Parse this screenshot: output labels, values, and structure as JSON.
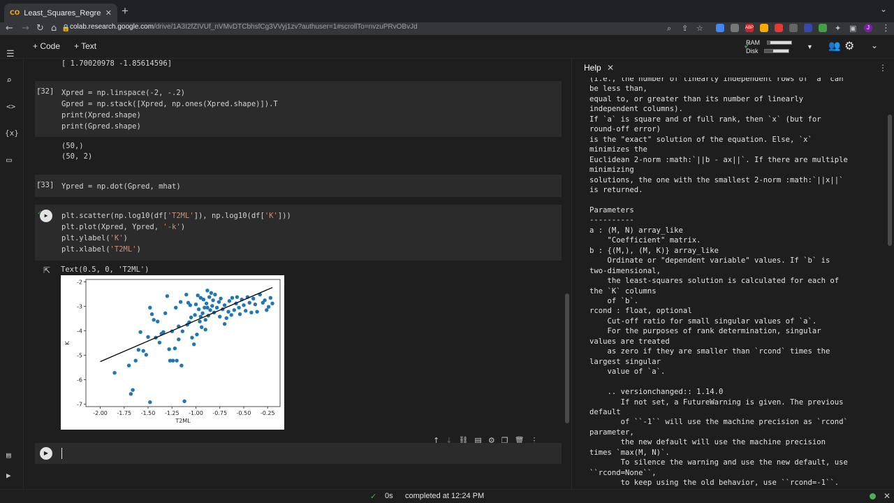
{
  "browser": {
    "tab_title": "Least_Squares_Regression_Py",
    "logo_text": "CO",
    "close_glyph": "✕",
    "new_tab_glyph": "+",
    "url_host": "colab.research.google.com",
    "url_path": "/drive/1A3I2fZIVUf_nVMvDTCbhsfCg3VVyj1zv?authuser=1#scrollTo=nvzuPRvOBvJd"
  },
  "toolbar": {
    "add_code": "+ Code",
    "add_text": "+ Text",
    "ram_label": "RAM",
    "disk_label": "Disk",
    "ram_fraction": 0.12,
    "disk_fraction": 0.38
  },
  "notebook": {
    "prev_output": "[ 1.70020978 -1.85614596]",
    "cells": [
      {
        "number": "[32]",
        "code": "Xpred = np.linspace(-2, -.2)\nGpred = np.stack([Xpred, np.ones(Xpred.shape)]).T\nprint(Xpred.shape)\nprint(Gpred.shape)",
        "output": "(50,)\n(50, 2)"
      },
      {
        "number": "[33]",
        "code": "Ypred = np.dot(Gpred, mhat)"
      },
      {
        "code_line1_a": "plt.scatter(np.log10(df[",
        "code_line1_s1": "'T2ML'",
        "code_line1_b": "]), np.log10(df[",
        "code_line1_s2": "'K'",
        "code_line1_c": "]))",
        "code_line2_a": "plt.plot(Xpred, Ypred, ",
        "code_line2_s": "'-k'",
        "code_line2_b": ")",
        "code_line3_a": "plt.ylabel(",
        "code_line3_s": "'K'",
        "code_line3_b": ")",
        "code_line4_a": "plt.xlabel(",
        "code_line4_s": "'T2ML'",
        "code_line4_b": ")",
        "output": "Text(0.5, 0, 'T2ML')"
      }
    ]
  },
  "chart_data": {
    "type": "scatter",
    "xlabel": "T2ML",
    "ylabel": "K",
    "xlim": [
      -2.15,
      -0.12
    ],
    "ylim": [
      -7.1,
      -1.9
    ],
    "xticks": [
      "-2.00",
      "-1.75",
      "-1.50",
      "-1.25",
      "-1.00",
      "-0.75",
      "-0.50",
      "-0.25"
    ],
    "xtick_values": [
      -2.0,
      -1.75,
      -1.5,
      -1.25,
      -1.0,
      -0.75,
      -0.5,
      -0.25
    ],
    "yticks": [
      "-2",
      "-3",
      "-4",
      "-5",
      "-6",
      "-7"
    ],
    "ytick_values": [
      -2,
      -3,
      -4,
      -5,
      -6,
      -7
    ],
    "line": {
      "x": [
        -2.0,
        -0.2
      ],
      "y": [
        -5.26,
        -2.23
      ],
      "color": "#000000"
    },
    "point_color": "#1f77b4",
    "points": [
      [
        -1.85,
        -5.72
      ],
      [
        -1.7,
        -5.42
      ],
      [
        -1.68,
        -6.58
      ],
      [
        -1.66,
        -6.42
      ],
      [
        -1.63,
        -5.22
      ],
      [
        -1.6,
        -4.78
      ],
      [
        -1.58,
        -4.05
      ],
      [
        -1.55,
        -4.82
      ],
      [
        -1.52,
        -4.98
      ],
      [
        -1.5,
        -4.25
      ],
      [
        -1.48,
        -6.92
      ],
      [
        -1.48,
        -3.05
      ],
      [
        -1.46,
        -3.32
      ],
      [
        -1.44,
        -3.55
      ],
      [
        -1.42,
        -4.28
      ],
      [
        -1.4,
        -3.62
      ],
      [
        -1.38,
        -4.48
      ],
      [
        -1.36,
        -4.12
      ],
      [
        -1.34,
        -4.05
      ],
      [
        -1.32,
        -3.28
      ],
      [
        -1.3,
        -2.58
      ],
      [
        -1.28,
        -4.75
      ],
      [
        -1.27,
        -5.22
      ],
      [
        -1.25,
        -4.02
      ],
      [
        -1.24,
        -5.22
      ],
      [
        -1.22,
        -4.72
      ],
      [
        -1.21,
        -3.05
      ],
      [
        -1.2,
        -5.22
      ],
      [
        -1.18,
        -3.82
      ],
      [
        -1.16,
        -2.82
      ],
      [
        -1.15,
        -5.42
      ],
      [
        -1.14,
        -4.02
      ],
      [
        -1.12,
        -6.88
      ],
      [
        -1.1,
        -2.52
      ],
      [
        -1.09,
        -3.75
      ],
      [
        -1.08,
        -2.85
      ],
      [
        -1.06,
        -2.95
      ],
      [
        -1.05,
        -3.45
      ],
      [
        -1.04,
        -4.28
      ],
      [
        -1.02,
        -4.55
      ],
      [
        -1.01,
        -3.35
      ],
      [
        -1.0,
        -2.92
      ],
      [
        -0.99,
        -4.15
      ],
      [
        -0.98,
        -2.55
      ],
      [
        -0.97,
        -3.12
      ],
      [
        -0.96,
        -3.62
      ],
      [
        -0.95,
        -2.65
      ],
      [
        -0.94,
        -3.85
      ],
      [
        -0.93,
        -3.28
      ],
      [
        -0.92,
        -2.72
      ],
      [
        -0.91,
        -3.05
      ],
      [
        -0.9,
        -3.55
      ],
      [
        -0.89,
        -2.88
      ],
      [
        -0.88,
        -2.35
      ],
      [
        -0.87,
        -3.38
      ],
      [
        -0.86,
        -2.62
      ],
      [
        -0.85,
        -3.15
      ],
      [
        -0.84,
        -2.45
      ],
      [
        -0.83,
        -2.98
      ],
      [
        -0.82,
        -2.75
      ],
      [
        -0.81,
        -3.25
      ],
      [
        -0.8,
        -2.52
      ],
      [
        -0.78,
        -3.05
      ],
      [
        -0.76,
        -2.82
      ],
      [
        -0.75,
        -3.42
      ],
      [
        -0.74,
        -2.68
      ],
      [
        -0.72,
        -3.12
      ],
      [
        -0.7,
        -2.95
      ],
      [
        -0.68,
        -3.48
      ],
      [
        -0.66,
        -3.22
      ],
      [
        -0.65,
        -2.78
      ],
      [
        -0.63,
        -3.35
      ],
      [
        -0.62,
        -2.65
      ],
      [
        -0.6,
        -3.15
      ],
      [
        -0.58,
        -2.88
      ],
      [
        -0.57,
        -2.62
      ],
      [
        -0.55,
        -3.05
      ],
      [
        -0.54,
        -3.32
      ],
      [
        -0.52,
        -2.72
      ],
      [
        -0.5,
        -2.95
      ],
      [
        -0.48,
        -3.18
      ],
      [
        -0.46,
        -2.62
      ],
      [
        -0.44,
        -2.85
      ],
      [
        -0.42,
        -3.25
      ],
      [
        -0.4,
        -2.68
      ],
      [
        -0.38,
        -2.92
      ],
      [
        -0.36,
        -3.22
      ],
      [
        -0.33,
        -2.52
      ],
      [
        -0.3,
        -2.85
      ],
      [
        -0.28,
        -2.75
      ],
      [
        -0.26,
        -3.15
      ],
      [
        -0.24,
        -3.02
      ],
      [
        -0.22,
        -2.65
      ],
      [
        -0.2,
        -2.88
      ],
      [
        -0.9,
        -3.95
      ],
      [
        -0.7,
        -3.72
      ],
      [
        -0.95,
        -3.42
      ],
      [
        -1.07,
        -3.65
      ],
      [
        -1.18,
        -4.35
      ],
      [
        -0.88,
        -3.05
      ]
    ]
  },
  "help": {
    "title": "Help",
    "close_glyph": "✕",
    "menu_glyph": "⋮",
    "lines": [
      "(i.e., the number of linearly independent rows of `a` can",
      "be less than,",
      "equal to, or greater than its number of linearly",
      "independent columns).",
      "If `a` is square and of full rank, then `x` (but for",
      "round-off error)",
      "is the \"exact\" solution of the equation. Else, `x`",
      "minimizes the",
      "Euclidean 2-norm :math:`||b - ax||`. If there are multiple",
      "minimizing",
      "solutions, the one with the smallest 2-norm :math:`||x||`",
      "is returned.",
      "",
      "Parameters",
      "----------",
      "a : (M, N) array_like",
      "    \"Coefficient\" matrix.",
      "b : {(M,), (M, K)} array_like",
      "    Ordinate or \"dependent variable\" values. If `b` is",
      "two-dimensional,",
      "    the least-squares solution is calculated for each of",
      "the `K` columns",
      "    of `b`.",
      "rcond : float, optional",
      "    Cut-off ratio for small singular values of `a`.",
      "    For the purposes of rank determination, singular",
      "values are treated",
      "    as zero if they are smaller than `rcond` times the",
      "largest singular",
      "    value of `a`.",
      "",
      "    .. versionchanged:: 1.14.0",
      "       If not set, a FutureWarning is given. The previous",
      "default",
      "       of ``-1`` will use the machine precision as `rcond`",
      "parameter,",
      "       the new default will use the machine precision",
      "times `max(M, N)`.",
      "       To silence the warning and use the new default, use",
      "``rcond=None``,",
      "       to keep using the old behavior, use ``rcond=-1``."
    ]
  },
  "status": {
    "check_glyph": "✓",
    "time": "0s",
    "text": "completed at 12:24 PM",
    "close_glyph": "✕"
  }
}
